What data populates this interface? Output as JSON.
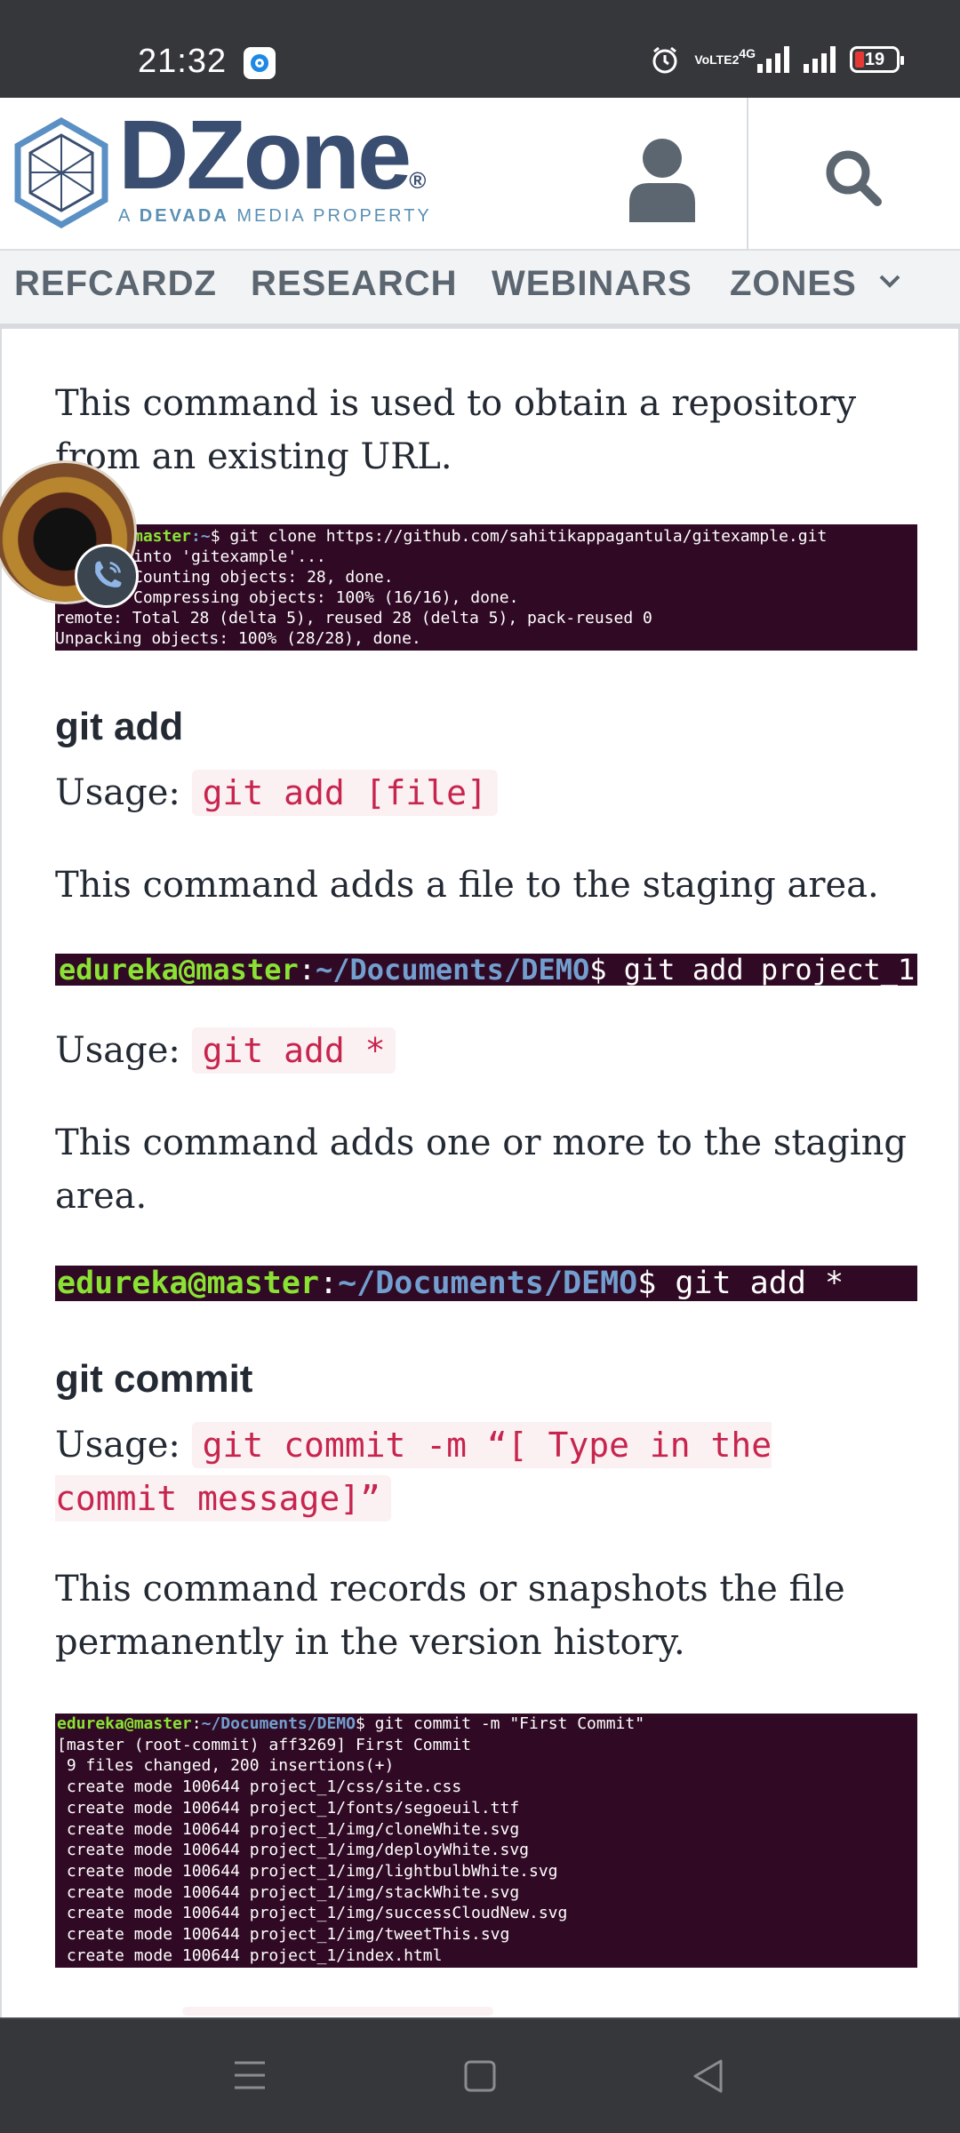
{
  "status_bar": {
    "time": "21:32",
    "battery": "19",
    "net_label": "4G",
    "volte": "VoLTE2"
  },
  "header": {
    "brand": "DZone",
    "brand_mark": "®",
    "tagline_prefix": "A ",
    "tagline_bold": "DEVADA",
    "tagline_suffix": " MEDIA PROPERTY",
    "user_icon": "user-icon",
    "search_icon": "search-icon"
  },
  "nav": {
    "items": [
      "REFCARDZ",
      "RESEARCH",
      "WEBINARS",
      "ZONES"
    ],
    "more_icon": "chevron-down-icon"
  },
  "article": {
    "clone_desc": "This command is used to obtain a repository from an existing URL.",
    "clone_terminal": [
      "master:~$ git clone https://github.com/sahitikappagantula/gitexample.git",
      "into 'gitexample'...",
      "Counting objects: 28, done.",
      "Compressing objects: 100% (16/16), done.",
      "remote: Total 28 (delta 5), reused 28 (delta 5), pack-reused 0",
      "Unpacking objects: 100% (28/28), done."
    ],
    "add_heading": "git add",
    "usage_label": "Usage:",
    "add_usage": "git add [file]",
    "add_desc": "This command adds a file to the staging area.",
    "add_term1": {
      "user": "edureka@master",
      "sep": ":",
      "path": "~/Documents/DEMO",
      "cmd": "$ git add project_1"
    },
    "add_usage2": "git add *",
    "add_desc2": "This command adds one or more to the staging area.",
    "add_term2": {
      "user": "edureka@master",
      "sep": ":",
      "path": "~/Documents/DEMO",
      "cmd": "$ git add *"
    },
    "commit_heading": "git commit",
    "commit_usage": "git commit -m “[ Type in the commit message]”",
    "commit_desc": "This command records or snapshots the file permanently in the version history.",
    "commit_term_prompt": {
      "user": "edureka@master",
      "sep": ":",
      "path": "~/Documents/DEMO",
      "cmd": "$ git commit -m \"First Commit\""
    },
    "commit_terminal": [
      "[master (root-commit) aff3269] First Commit",
      " 9 files changed, 200 insertions(+)",
      " create mode 100644 project_1/css/site.css",
      " create mode 100644 project_1/fonts/segoeuil.ttf",
      " create mode 100644 project_1/img/cloneWhite.svg",
      " create mode 100644 project_1/img/deployWhite.svg",
      " create mode 100644 project_1/img/lightbulbWhite.svg",
      " create mode 100644 project_1/img/stackWhite.svg",
      " create mode 100644 project_1/img/successCloudNew.svg",
      " create mode 100644 project_1/img/tweetThis.svg",
      " create mode 100644 project_1/index.html"
    ]
  },
  "colors": {
    "brand": "#3a4e71",
    "accent_code": "#c7254e",
    "terminal_bg": "#300a24"
  }
}
